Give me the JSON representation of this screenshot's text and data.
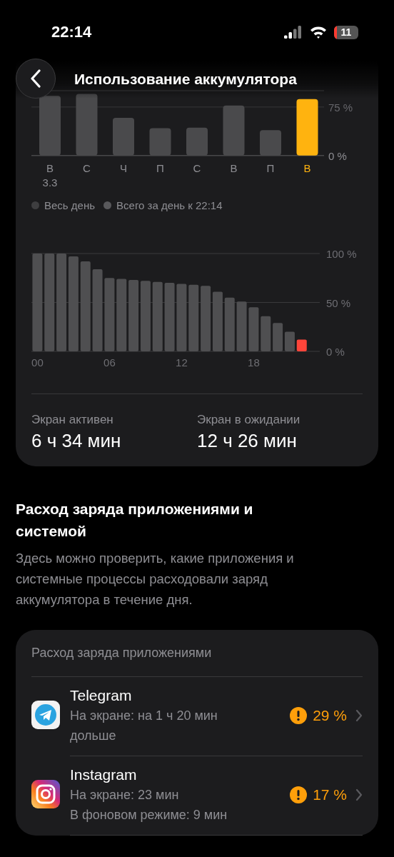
{
  "status_bar": {
    "time": "22:14",
    "battery": "11"
  },
  "header": {
    "title": "Использование аккумулятора"
  },
  "week_chart": {
    "first_date": "3.3",
    "chart_data": {
      "type": "bar",
      "categories": [
        "В",
        "С",
        "Ч",
        "П",
        "С",
        "В",
        "П",
        "В"
      ],
      "ylim": [
        0,
        100
      ],
      "yticks": [
        {
          "value": 0,
          "label": "0 %"
        },
        {
          "value": 75,
          "label": "75 %"
        }
      ],
      "series": [
        {
          "color": "#4a4a4c",
          "values": [
            92,
            95,
            58,
            42,
            43,
            77,
            39,
            null
          ]
        },
        {
          "color": "#ffb30f",
          "values": [
            null,
            null,
            null,
            null,
            null,
            null,
            null,
            87
          ]
        }
      ]
    }
  },
  "legend": [
    {
      "label": "Весь день",
      "color": "#3e3e40"
    },
    {
      "label": "Всего за день к 22:14",
      "color": "#59595c"
    }
  ],
  "day_chart": {
    "chart_data": {
      "type": "bar",
      "x": [
        0,
        1,
        2,
        3,
        4,
        5,
        6,
        7,
        8,
        9,
        10,
        11,
        12,
        13,
        14,
        15,
        16,
        17,
        18,
        19,
        20,
        21,
        22
      ],
      "xlim": [
        -0.5,
        23.5
      ],
      "xticks": [
        {
          "value": 0,
          "label": "00"
        },
        {
          "value": 6,
          "label": "06"
        },
        {
          "value": 12,
          "label": "12"
        },
        {
          "value": 18,
          "label": "18"
        }
      ],
      "ylim": [
        0,
        100
      ],
      "yticks": [
        {
          "value": 0,
          "label": "0 %"
        },
        {
          "value": 50,
          "label": "50 %"
        },
        {
          "value": 100,
          "label": "100 %"
        }
      ],
      "series": [
        {
          "color": "#4f4f51",
          "values": [
            100,
            100,
            100,
            97,
            92,
            84,
            75,
            74,
            73,
            72,
            71,
            70,
            69,
            68,
            67,
            61,
            55,
            51,
            45,
            36,
            29,
            20,
            null
          ]
        },
        {
          "color": "#ff453a",
          "values": [
            null,
            null,
            null,
            null,
            null,
            null,
            null,
            null,
            null,
            null,
            null,
            null,
            null,
            null,
            null,
            null,
            null,
            null,
            null,
            null,
            null,
            null,
            12
          ]
        }
      ]
    }
  },
  "stats": [
    {
      "label": "Экран активен",
      "value": "6 ч 34 мин"
    },
    {
      "label": "Экран в ожидании",
      "value": "12 ч 26 мин"
    }
  ],
  "section": {
    "title": "Расход заряда приложениями и системой",
    "description": "Здесь можно проверить, какие приложения и системные процессы расходовали заряд аккумулятора в течение дня."
  },
  "apps_card": {
    "title": "Расход заряда приложениями",
    "apps": [
      {
        "kind": "telegram",
        "name": "Telegram",
        "details": [
          "На экране: на 1 ч 20 мин дольше"
        ],
        "share": "29 %",
        "warning": true
      },
      {
        "kind": "instagram",
        "name": "Instagram",
        "details": [
          "На экране: 23 мин",
          "В фоновом режиме: 9 мин"
        ],
        "share": "17 %",
        "warning": true
      }
    ]
  }
}
